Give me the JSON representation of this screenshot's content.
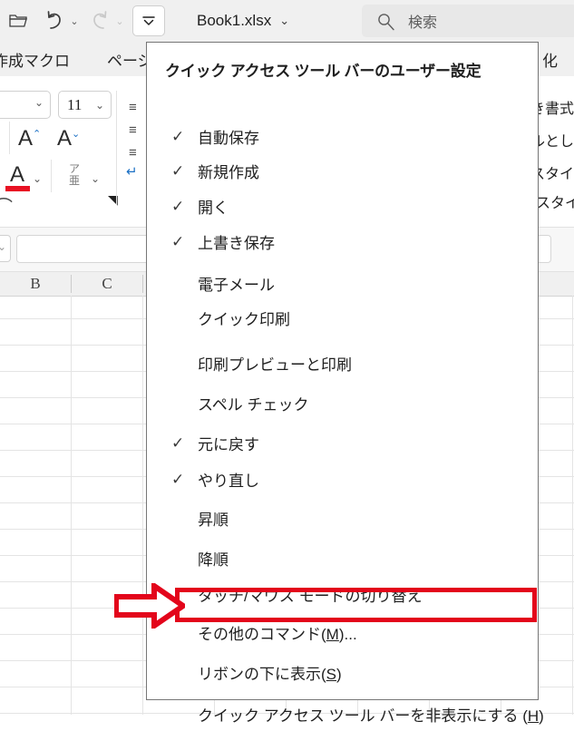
{
  "app": {
    "document_title": "Book1.xlsx",
    "search_placeholder": "検索",
    "title_chevron": "⌄"
  },
  "quick_access_toolbar": {
    "items": [
      {
        "name": "open-icon",
        "glyph": "🗁"
      },
      {
        "name": "undo-icon",
        "glyph": "↺",
        "caret": "⌄"
      },
      {
        "name": "redo-icon",
        "glyph": "↻",
        "caret": "⌄"
      },
      {
        "name": "customize-qat-icon",
        "glyph": "⩗"
      }
    ]
  },
  "ribbon": {
    "tabs": [
      {
        "label": "作成マクロ"
      },
      {
        "label": "ページ"
      },
      {
        "label": "化"
      }
    ],
    "font_group": {
      "font_size": "11",
      "grow_font": "A",
      "shrink_font": "A",
      "font_color": "A",
      "phonetic": "ア亜",
      "caret": "⌄",
      "dialog_launcher": "◥"
    },
    "styles_group": {
      "items": [
        "き書式",
        "ルとして",
        "スタイル",
        "スタイ"
      ]
    }
  },
  "menu": {
    "header": "クイック アクセス ツール バーのユーザー設定",
    "items": [
      {
        "label": "自動保存",
        "checked": true
      },
      {
        "label": "新規作成",
        "checked": true
      },
      {
        "label": "開く",
        "checked": true
      },
      {
        "label": "上書き保存",
        "checked": true
      },
      {
        "label": "電子メール",
        "checked": false
      },
      {
        "label": "クイック印刷",
        "checked": false
      },
      {
        "label": "印刷プレビューと印刷",
        "checked": false
      },
      {
        "label": "スペル チェック",
        "checked": false
      },
      {
        "label": "元に戻す",
        "checked": true
      },
      {
        "label": "やり直し",
        "checked": true
      },
      {
        "label": "昇順",
        "checked": false
      },
      {
        "label": "降順",
        "checked": false
      },
      {
        "label": "タッチ/マウス モードの切り替え",
        "checked": false
      },
      {
        "label": "その他のコマンド(M)...",
        "checked": false,
        "accel": "M",
        "highlighted": true
      },
      {
        "label": "リボンの下に表示(S)",
        "checked": false,
        "accel": "S"
      },
      {
        "label": "クイック アクセス ツール バーを非表示にする (H)",
        "checked": false,
        "accel": "H"
      }
    ],
    "check_glyph": "✓"
  },
  "grid": {
    "column_headers": [
      "B",
      "C"
    ]
  },
  "annotation": {
    "highlight_color": "#e3051b",
    "arrow_name": "red-arrow-pointing-right",
    "target_item": "その他のコマンド(M)..."
  }
}
